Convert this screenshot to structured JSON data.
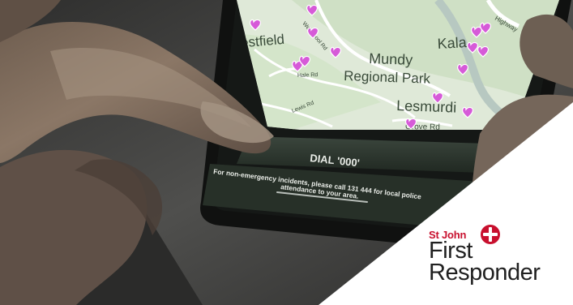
{
  "map": {
    "labels": [
      "restfield",
      "Mundy",
      "Regional Park",
      "Lesmurdi",
      "Kala",
      "Hale Rd",
      "Lewis Rd",
      "Grove Rd",
      "Welshpool Rd",
      "Highway"
    ]
  },
  "phone": {
    "dial_label": "DIAL '000'",
    "notice_line1": "For non-emergency incidents, please call 131 444 for local police",
    "notice_line2": "attendance to your area."
  },
  "brand": {
    "top": "St John",
    "name_line1": "First",
    "name_line2": "Responder"
  }
}
